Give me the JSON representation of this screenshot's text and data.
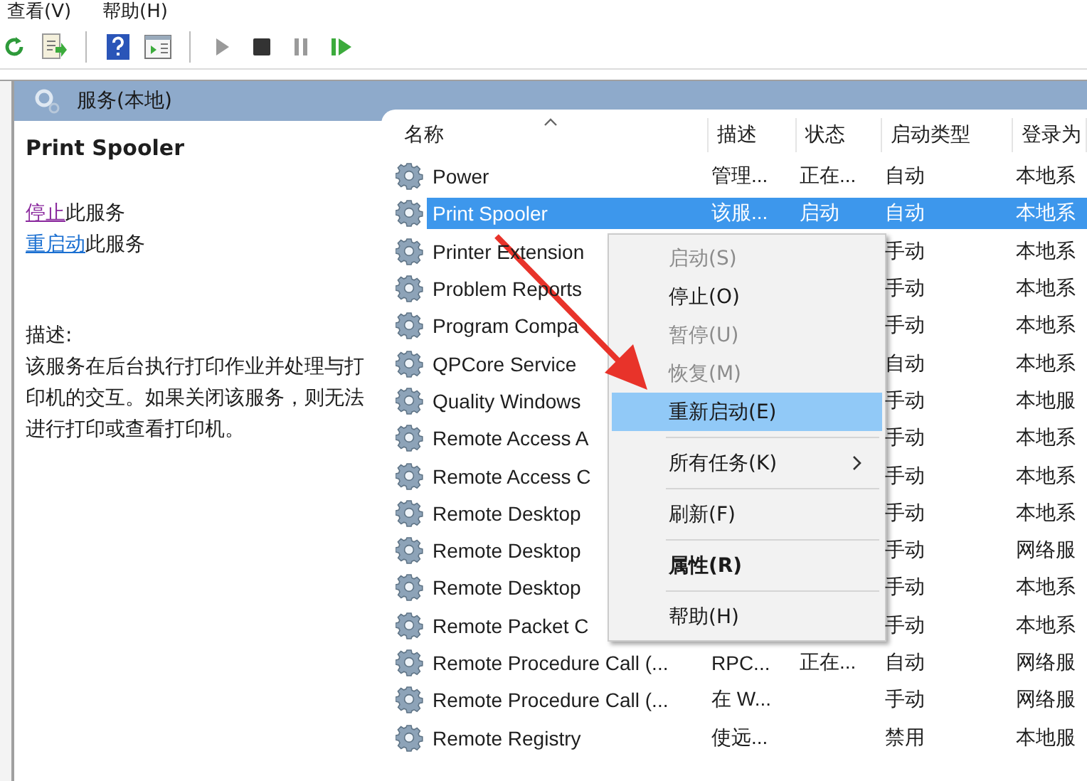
{
  "menu_bar": [
    "查看(V)",
    "帮助(H)"
  ],
  "toolbar": [
    {
      "kind": "refresh"
    },
    {
      "kind": "export"
    },
    {
      "kind": "sep"
    },
    {
      "kind": "help"
    },
    {
      "kind": "console"
    },
    {
      "kind": "sep"
    },
    {
      "kind": "play",
      "disabled": true
    },
    {
      "kind": "stop",
      "disabled": false
    },
    {
      "kind": "pause",
      "disabled": true
    },
    {
      "kind": "resume",
      "disabled": false
    }
  ],
  "header": {
    "title": "服务(本地)"
  },
  "detail": {
    "title": "Print Spooler",
    "actions": [
      {
        "link": "停止",
        "rest": "此服务",
        "visited": true
      },
      {
        "link": "重启动",
        "rest": "此服务",
        "visited": false
      }
    ],
    "description_label": "描述:",
    "description": "该服务在后台执行打印作业并处理与打印机的交互。如果关闭该服务，则无法进行打印或查看打印机。"
  },
  "table": {
    "columns": [
      "名称",
      "描述",
      "状态",
      "启动类型",
      "登录为"
    ],
    "rows": [
      {
        "name": "Power",
        "description": "管理...",
        "status": "正在...",
        "startup": "自动",
        "logon": "本地系",
        "selected": false
      },
      {
        "name": "Print Spooler",
        "description": "该服...",
        "status": "启动",
        "startup": "自动",
        "logon": "本地系",
        "selected": true
      },
      {
        "name": "Printer Extension",
        "startup": "手动",
        "logon": "本地系",
        "selected": false
      },
      {
        "name": "Problem Reports",
        "startup": "手动",
        "logon": "本地系",
        "selected": false
      },
      {
        "name": "Program Compa",
        "startup": "手动",
        "logon": "本地系",
        "selected": false
      },
      {
        "name": "QPCore Service",
        "startup": "自动",
        "logon": "本地系",
        "selected": false
      },
      {
        "name": "Quality Windows",
        "startup": "手动",
        "logon": "本地服",
        "selected": false
      },
      {
        "name": "Remote Access A",
        "startup": "手动",
        "logon": "本地系",
        "selected": false
      },
      {
        "name": "Remote Access C",
        "startup": "手动",
        "logon": "本地系",
        "selected": false
      },
      {
        "name": "Remote Desktop",
        "startup": "手动",
        "logon": "本地系",
        "selected": false
      },
      {
        "name": "Remote Desktop",
        "startup": "手动",
        "logon": "网络服",
        "selected": false
      },
      {
        "name": "Remote Desktop",
        "startup": "手动",
        "logon": "本地系",
        "selected": false
      },
      {
        "name": "Remote Packet C",
        "startup": "手动",
        "logon": "本地系",
        "selected": false
      },
      {
        "name": "Remote Procedure Call (...",
        "description": "RPC...",
        "status": "正在...",
        "startup": "自动",
        "logon": "网络服",
        "selected": false
      },
      {
        "name": "Remote Procedure Call (...",
        "description": "在 W...",
        "startup": "手动",
        "logon": "网络服",
        "selected": false
      },
      {
        "name": "Remote Registry",
        "description": "使远...",
        "startup": "禁用",
        "logon": "本地服",
        "selected": false
      }
    ]
  },
  "context_menu": [
    {
      "kind": "item",
      "label": "启动(S)",
      "disabled": true,
      "selected": false
    },
    {
      "kind": "item",
      "label": "停止(O)",
      "disabled": false,
      "selected": false
    },
    {
      "kind": "item",
      "label": "暂停(U)",
      "disabled": true,
      "selected": false
    },
    {
      "kind": "item",
      "label": "恢复(M)",
      "disabled": true,
      "selected": false
    },
    {
      "kind": "item",
      "label": "重新启动(E)",
      "disabled": false,
      "selected": true
    },
    {
      "kind": "separator"
    },
    {
      "kind": "submenu",
      "label": "所有任务(K)",
      "disabled": false,
      "selected": false
    },
    {
      "kind": "separator"
    },
    {
      "kind": "item",
      "label": "刷新(F)",
      "disabled": false,
      "selected": false
    },
    {
      "kind": "separator"
    },
    {
      "kind": "default",
      "label": "属性(R)",
      "disabled": false,
      "selected": false
    },
    {
      "kind": "separator"
    },
    {
      "kind": "item",
      "label": "帮助(H)",
      "disabled": false,
      "selected": false
    }
  ],
  "annotation": {
    "kind": "arrow"
  }
}
